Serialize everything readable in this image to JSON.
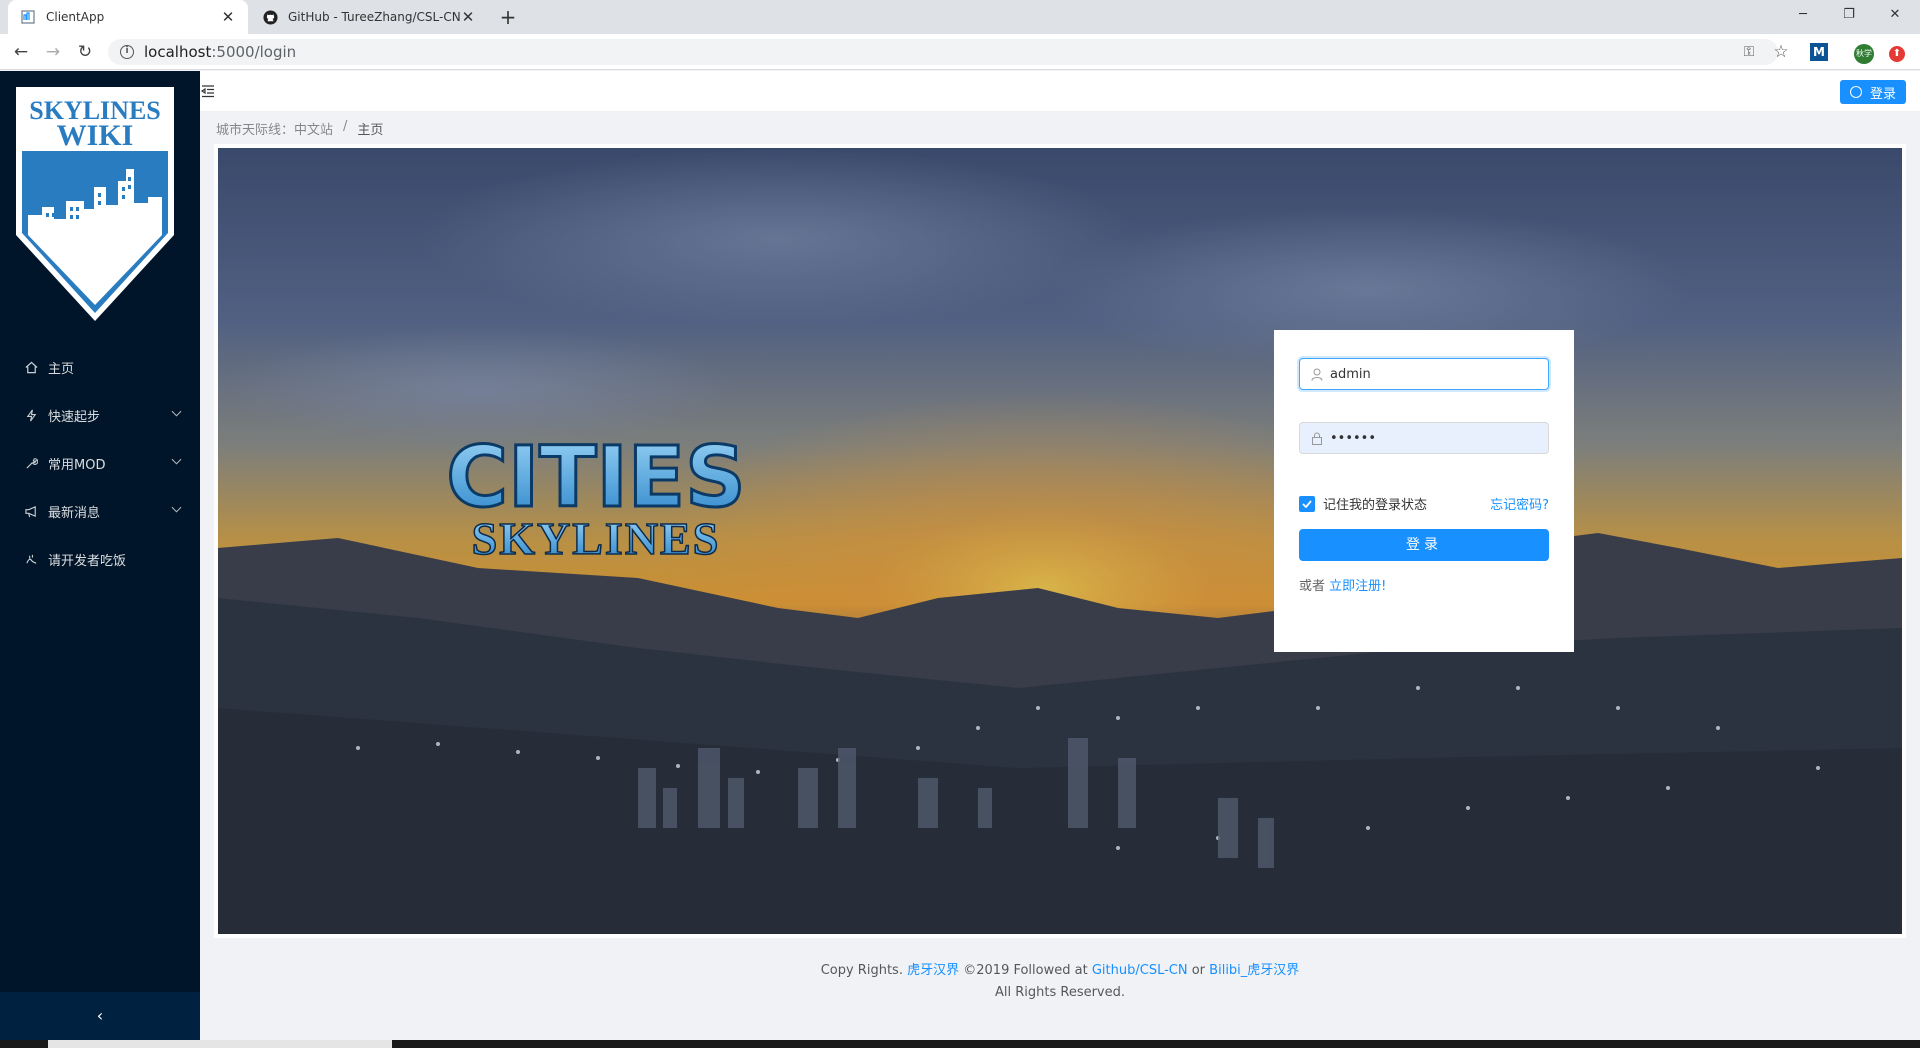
{
  "browser": {
    "tabs": [
      {
        "title": "ClientApp",
        "active": true
      },
      {
        "title": "GitHub - TureeZhang/CSL-CN",
        "active": false
      }
    ],
    "new_tab": "+",
    "url_host": "localhost",
    "url_rest": ":5000/login",
    "ext_m": "M",
    "ext_avatar": "秋学"
  },
  "sidebar": {
    "logo_text_1": "SKYLINES",
    "logo_text_2": "WIKI",
    "items": [
      {
        "label": "主页",
        "icon": "home-icon",
        "has_arrow": false
      },
      {
        "label": "快速起步",
        "icon": "bolt-icon",
        "has_arrow": true
      },
      {
        "label": "常用MOD",
        "icon": "wrench-icon",
        "has_arrow": true
      },
      {
        "label": "最新消息",
        "icon": "megaphone-icon",
        "has_arrow": true
      },
      {
        "label": "请开发者吃饭",
        "icon": "coffee-icon",
        "has_arrow": false
      }
    ],
    "collapse": "‹"
  },
  "header": {
    "login_label": "登录"
  },
  "breadcrumb": {
    "items": [
      "城市天际线：中文站",
      "/",
      "主页"
    ]
  },
  "hero": {
    "logo_line_1": "CITIES",
    "logo_line_2": "SKYLINES"
  },
  "login_form": {
    "username_value": "admin",
    "password_value": "••••••",
    "remember_label": "记住我的登录状态",
    "remember_checked": true,
    "forgot_label": "忘记密码?",
    "submit_label": "登录",
    "or_label": "或者",
    "register_label": "立即注册!"
  },
  "footer": {
    "line1_prefix": "Copy Rights.",
    "author": "虎牙汉界",
    "year_text": "©2019 Followed at",
    "github": "Github/CSL-CN",
    "or": "or",
    "bilibili": "Bilibi_虎牙汉界",
    "line2": "All Rights Reserved."
  },
  "colors": {
    "primary": "#1890ff",
    "sidebar_bg": "#001529",
    "sidebar_collapse_bg": "#002140"
  }
}
